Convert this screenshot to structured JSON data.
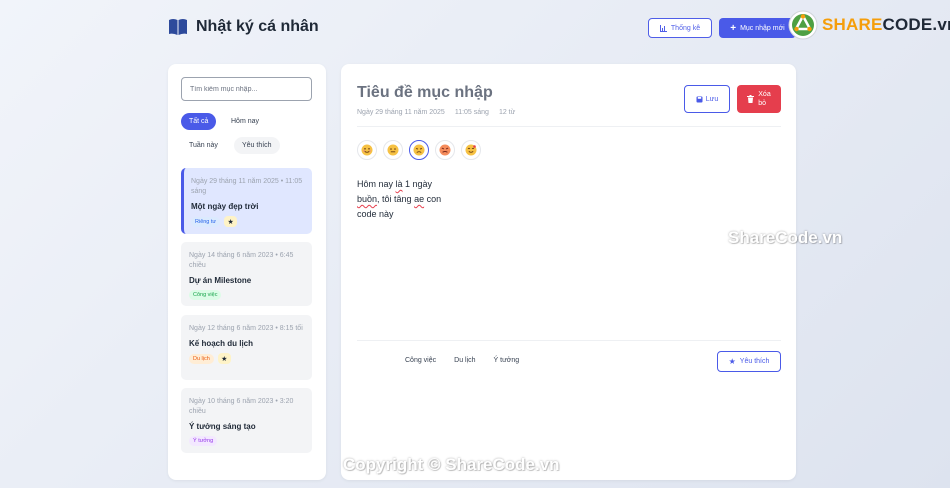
{
  "header": {
    "title": "Nhật ký cá nhân",
    "stats_label": "Thống kê",
    "new_entry_label": "Mục nhập mới"
  },
  "brand": {
    "part1": "SHARE",
    "part2": "CODE.vn"
  },
  "sidebar": {
    "search_placeholder": "Tìm kiếm mục nhập...",
    "filters": [
      "Tất cả",
      "Hôm nay",
      "Tuần này",
      "Yêu thích"
    ],
    "entries": [
      {
        "date": "Ngày 29 tháng 11 năm 2025 • 11:05 sáng",
        "title": "Một ngày đẹp trời",
        "tag": "Riêng tư",
        "favorite": true
      },
      {
        "date": "Ngày 14 tháng 6 năm 2023 • 6:45 chiều",
        "title": "Dự án Milestone",
        "tag": "Công việc",
        "favorite": false
      },
      {
        "date": "Ngày 12 tháng 6 năm 2023 • 8:15 tối",
        "title": "Kế hoạch du lịch",
        "tag": "Du lịch",
        "favorite": true
      },
      {
        "date": "Ngày 10 tháng 6 năm 2023 • 3:20 chiều",
        "title": "Ý tưởng sáng tạo",
        "tag": "Ý tưởng",
        "favorite": false
      }
    ]
  },
  "main": {
    "heading": "Tiêu đề mục nhập",
    "date": "Ngày 29 tháng 11 năm 2025",
    "time": "11:05 sáng",
    "word_count": "12 từ",
    "save_label": "Lưu",
    "delete_label_1": "Xóa",
    "delete_label_2": "bỏ",
    "content": {
      "l1a": "Hôm nay ",
      "l1b": "là",
      "l1c": " 1 ngày",
      "l2a": "buồn",
      "l2b": ", tôi tâng ",
      "l2c": "ae",
      "l2d": " con",
      "l3": "code này"
    },
    "tags": [
      "Công việc",
      "Du lịch",
      "Ý tưởng"
    ],
    "favorite_label": "Yêu thích"
  },
  "watermarks": {
    "mid": "ShareCode.vn",
    "bottom": "Copyright © ShareCode.vn"
  },
  "colors": {
    "accent": "#4a5ae8",
    "danger": "#e53e4d"
  }
}
